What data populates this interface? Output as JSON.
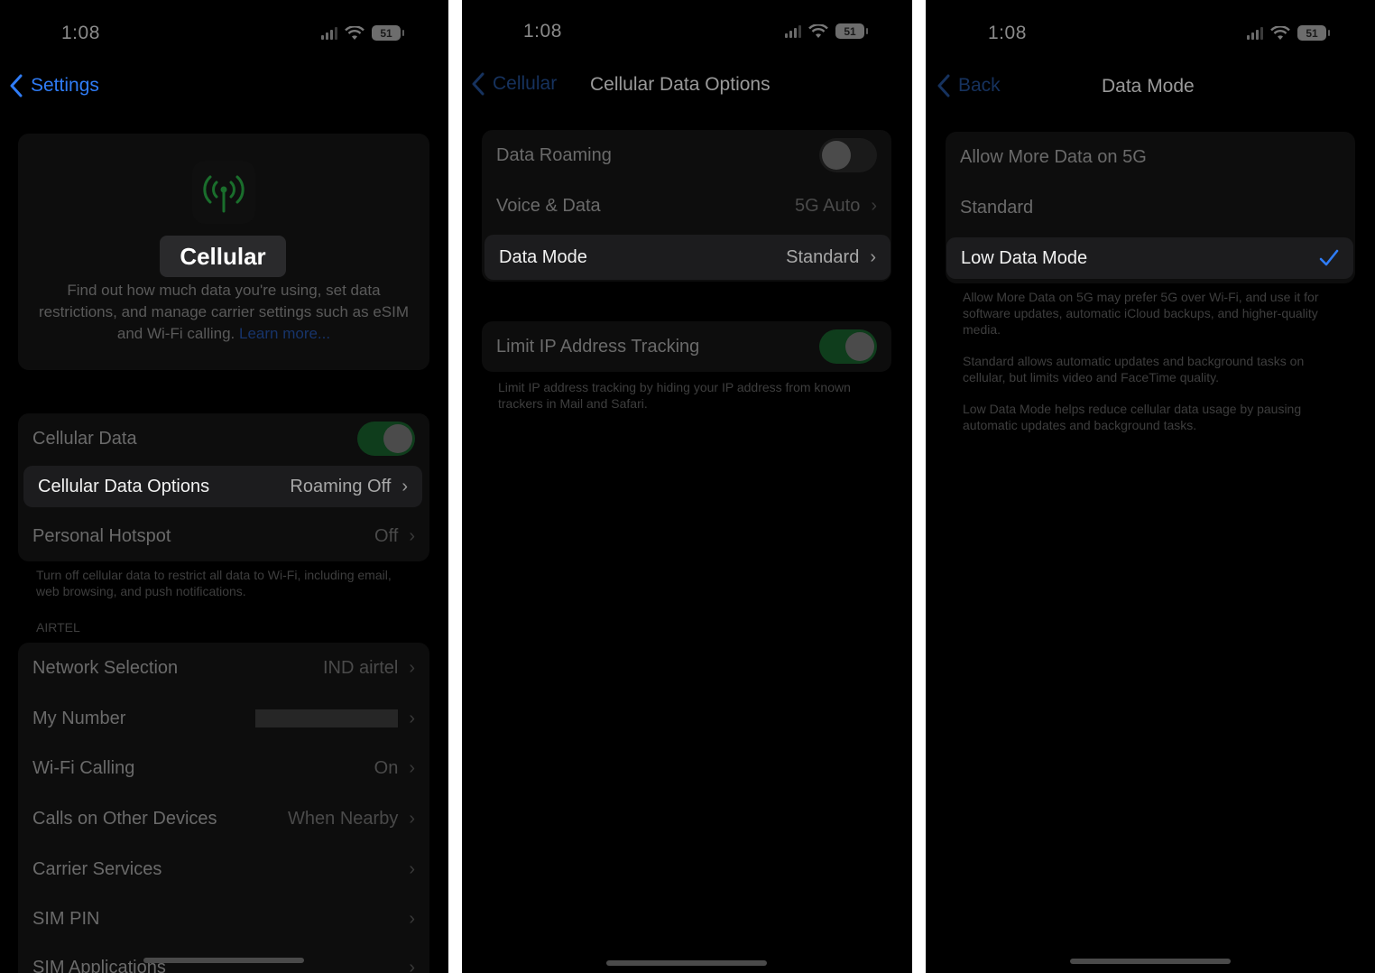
{
  "status": {
    "time": "1:08",
    "battery": "51"
  },
  "screen1": {
    "back_label": "Settings",
    "header_title": "Cellular",
    "description": "Find out how much data you're using, set data restrictions, and manage carrier settings such as eSIM and Wi-Fi calling.",
    "learn_more": "Learn more...",
    "cellular_data": "Cellular Data",
    "options_label": "Cellular Data Options",
    "options_value": "Roaming Off",
    "hotspot_label": "Personal Hotspot",
    "hotspot_value": "Off",
    "footnote": "Turn off cellular data to restrict all data to Wi-Fi, including email, web browsing, and push notifications.",
    "carrier_header": "AIRTEL",
    "rows": [
      {
        "label": "Network Selection",
        "value": "IND airtel"
      },
      {
        "label": "My Number",
        "value": ""
      },
      {
        "label": "Wi-Fi Calling",
        "value": "On"
      },
      {
        "label": "Calls on Other Devices",
        "value": "When Nearby"
      },
      {
        "label": "Carrier Services",
        "value": ""
      },
      {
        "label": "SIM PIN",
        "value": ""
      },
      {
        "label": "SIM Applications",
        "value": ""
      }
    ]
  },
  "screen2": {
    "back_label": "Cellular",
    "title": "Cellular Data Options",
    "roaming_label": "Data Roaming",
    "voice_label": "Voice & Data",
    "voice_value": "5G Auto",
    "mode_label": "Data Mode",
    "mode_value": "Standard",
    "limit_label": "Limit IP Address Tracking",
    "limit_footnote": "Limit IP address tracking by hiding your IP address from known trackers in Mail and Safari."
  },
  "screen3": {
    "back_label": "Back",
    "title": "Data Mode",
    "options": [
      "Allow More Data on 5G",
      "Standard",
      "Low Data Mode"
    ],
    "note1": "Allow More Data on 5G may prefer 5G over Wi-Fi, and use it for software updates, automatic iCloud backups, and higher-quality media.",
    "note2": "Standard allows automatic updates and background tasks on cellular, but limits video and FaceTime quality.",
    "note3": "Low Data Mode helps reduce cellular data usage by pausing automatic updates and background tasks."
  },
  "colors": {
    "accent": "#2f7cf6",
    "green": "#1e8c3a"
  },
  "icons": [
    "chevron-left-icon",
    "antenna-icon",
    "chevron-right-icon",
    "checkmark-icon",
    "wifi-icon",
    "signal-icon",
    "battery-icon"
  ]
}
